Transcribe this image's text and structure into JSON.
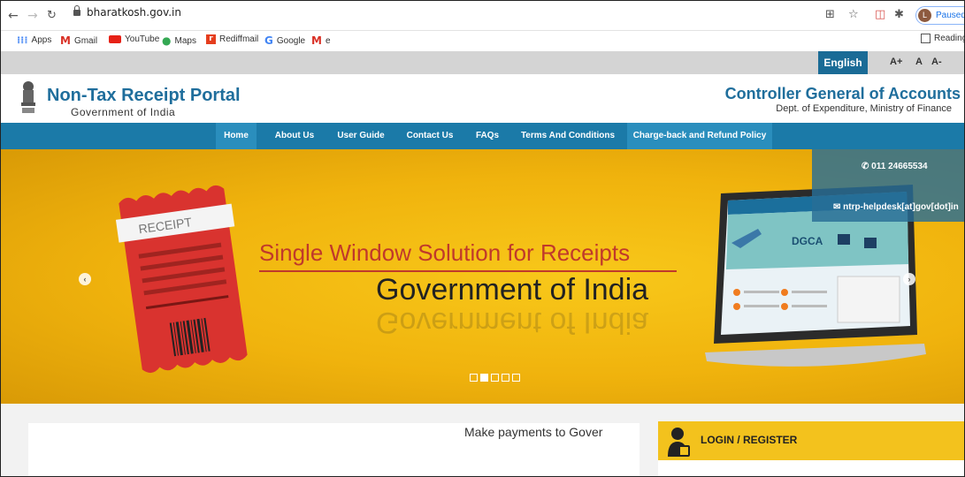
{
  "browser": {
    "url": "bharatkosh.gov.in",
    "profile_initial": "L",
    "profile_status": "Paused",
    "bookmarks": [
      {
        "label": "Apps",
        "icon": "apps-grid-icon"
      },
      {
        "label": "Gmail",
        "icon": "gmail-icon"
      },
      {
        "label": "YouTube",
        "icon": "youtube-icon"
      },
      {
        "label": "Maps",
        "icon": "maps-pin-icon"
      },
      {
        "label": "Rediffmail",
        "icon": "rediffmail-icon"
      },
      {
        "label": "Google",
        "icon": "google-icon"
      },
      {
        "label": "e",
        "icon": "gmail-icon"
      }
    ],
    "reading_list": "Reading"
  },
  "site": {
    "language": "English",
    "font_size": {
      "increase": "A+",
      "normal": "A",
      "decrease": "A-"
    },
    "header": {
      "title": "Non-Tax Receipt Portal",
      "subtitle": "Government of India",
      "org_title": "Controller General of Accounts",
      "org_subtitle": "Dept. of Expenditure, Ministry of Finance"
    },
    "menu": [
      "Home",
      "About Us",
      "User Guide",
      "Contact Us",
      "FAQs",
      "Terms And Conditions",
      "Charge-back and Refund Policy"
    ],
    "banner": {
      "line1": "Single Window Solution for Receipts",
      "line2": "Government of India",
      "receipt_label": "RECEIPT",
      "screen_label": "DGCA"
    },
    "contact": {
      "phone": "011 24665534",
      "email": "ntrp-helpdesk[at]gov[dot]in"
    },
    "marquee": "Make payments to Gover",
    "login": "LOGIN / REGISTER"
  },
  "colors": {
    "brand_blue": "#1b7aa8",
    "banner_yellow": "#f0b30d",
    "login_yellow": "#f3c21d"
  }
}
